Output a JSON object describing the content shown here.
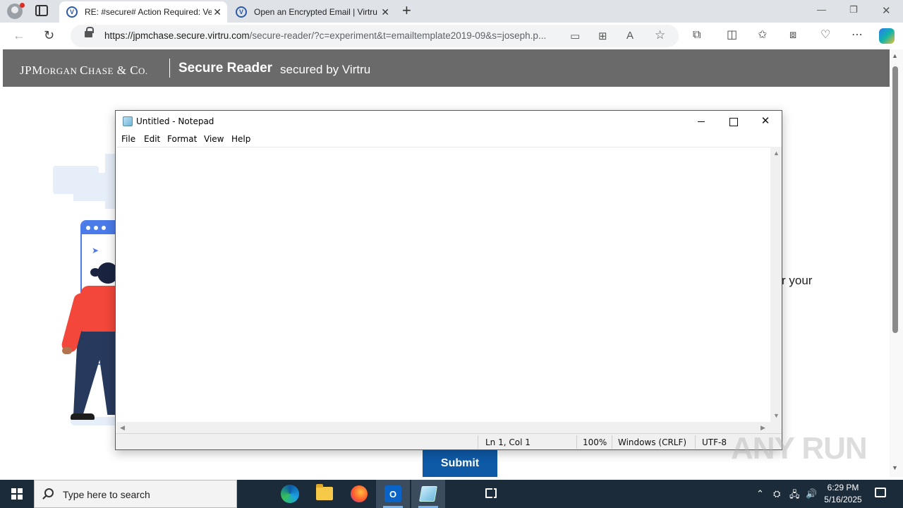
{
  "browser": {
    "tabs": [
      {
        "title": "RE: #secure# Action Required: Ve",
        "active": true
      },
      {
        "title": "Open an Encrypted Email | Virtru",
        "active": false
      }
    ],
    "url_host": "https://jpmchase.secure.virtru.com",
    "url_path": "/secure-reader/?c=experiment&t=emailtemplate2019-09&s=joseph.p...",
    "icons": [
      "profile-icon",
      "tab-actions-icon",
      "back-icon",
      "refresh-icon",
      "lock-icon",
      "app-available-icon",
      "qr-icon",
      "read-aloud-icon",
      "favorite-icon",
      "extensions-icon",
      "split-screen-icon",
      "favorites-icon",
      "collections-icon",
      "browser-essentials-icon",
      "more-icon",
      "copilot-icon"
    ]
  },
  "page": {
    "brand_main": "JPM",
    "brand_small1": "ORGAN ",
    "brand_c": "C",
    "brand_small2": "HASE",
    "brand_tail": " & C",
    "brand_small3": "O.",
    "product": "Secure Reader",
    "secured_by": "secured by Virtru",
    "visible_text_fragment": "r your",
    "submit_label": "Submit"
  },
  "notepad": {
    "title": "Untitled - Notepad",
    "menu": [
      "File",
      "Edit",
      "Format",
      "View",
      "Help"
    ],
    "content": "",
    "status": {
      "position": "Ln 1, Col 1",
      "zoom": "100%",
      "line_ending": "Windows (CRLF)",
      "encoding": "UTF-8"
    }
  },
  "taskbar": {
    "search_placeholder": "Type here to search",
    "apps": [
      "task-view",
      "edge",
      "file-explorer",
      "firefox",
      "outlook",
      "notepad"
    ],
    "active_app": "notepad",
    "time": "6:29 PM",
    "date": "5/16/2025"
  },
  "watermark": "ANY RUN"
}
